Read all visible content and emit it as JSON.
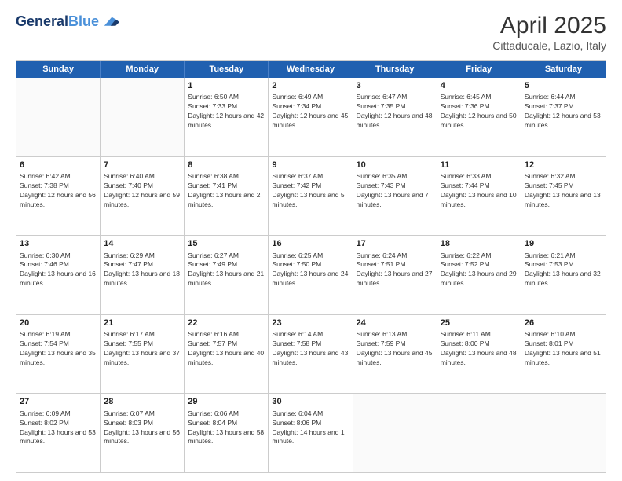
{
  "logo": {
    "line1": "General",
    "line2": "Blue"
  },
  "title": "April 2025",
  "subtitle": "Cittaducale, Lazio, Italy",
  "header_days": [
    "Sunday",
    "Monday",
    "Tuesday",
    "Wednesday",
    "Thursday",
    "Friday",
    "Saturday"
  ],
  "weeks": [
    [
      {
        "day": "",
        "info": ""
      },
      {
        "day": "",
        "info": ""
      },
      {
        "day": "1",
        "info": "Sunrise: 6:50 AM\nSunset: 7:33 PM\nDaylight: 12 hours and 42 minutes."
      },
      {
        "day": "2",
        "info": "Sunrise: 6:49 AM\nSunset: 7:34 PM\nDaylight: 12 hours and 45 minutes."
      },
      {
        "day": "3",
        "info": "Sunrise: 6:47 AM\nSunset: 7:35 PM\nDaylight: 12 hours and 48 minutes."
      },
      {
        "day": "4",
        "info": "Sunrise: 6:45 AM\nSunset: 7:36 PM\nDaylight: 12 hours and 50 minutes."
      },
      {
        "day": "5",
        "info": "Sunrise: 6:44 AM\nSunset: 7:37 PM\nDaylight: 12 hours and 53 minutes."
      }
    ],
    [
      {
        "day": "6",
        "info": "Sunrise: 6:42 AM\nSunset: 7:38 PM\nDaylight: 12 hours and 56 minutes."
      },
      {
        "day": "7",
        "info": "Sunrise: 6:40 AM\nSunset: 7:40 PM\nDaylight: 12 hours and 59 minutes."
      },
      {
        "day": "8",
        "info": "Sunrise: 6:38 AM\nSunset: 7:41 PM\nDaylight: 13 hours and 2 minutes."
      },
      {
        "day": "9",
        "info": "Sunrise: 6:37 AM\nSunset: 7:42 PM\nDaylight: 13 hours and 5 minutes."
      },
      {
        "day": "10",
        "info": "Sunrise: 6:35 AM\nSunset: 7:43 PM\nDaylight: 13 hours and 7 minutes."
      },
      {
        "day": "11",
        "info": "Sunrise: 6:33 AM\nSunset: 7:44 PM\nDaylight: 13 hours and 10 minutes."
      },
      {
        "day": "12",
        "info": "Sunrise: 6:32 AM\nSunset: 7:45 PM\nDaylight: 13 hours and 13 minutes."
      }
    ],
    [
      {
        "day": "13",
        "info": "Sunrise: 6:30 AM\nSunset: 7:46 PM\nDaylight: 13 hours and 16 minutes."
      },
      {
        "day": "14",
        "info": "Sunrise: 6:29 AM\nSunset: 7:47 PM\nDaylight: 13 hours and 18 minutes."
      },
      {
        "day": "15",
        "info": "Sunrise: 6:27 AM\nSunset: 7:49 PM\nDaylight: 13 hours and 21 minutes."
      },
      {
        "day": "16",
        "info": "Sunrise: 6:25 AM\nSunset: 7:50 PM\nDaylight: 13 hours and 24 minutes."
      },
      {
        "day": "17",
        "info": "Sunrise: 6:24 AM\nSunset: 7:51 PM\nDaylight: 13 hours and 27 minutes."
      },
      {
        "day": "18",
        "info": "Sunrise: 6:22 AM\nSunset: 7:52 PM\nDaylight: 13 hours and 29 minutes."
      },
      {
        "day": "19",
        "info": "Sunrise: 6:21 AM\nSunset: 7:53 PM\nDaylight: 13 hours and 32 minutes."
      }
    ],
    [
      {
        "day": "20",
        "info": "Sunrise: 6:19 AM\nSunset: 7:54 PM\nDaylight: 13 hours and 35 minutes."
      },
      {
        "day": "21",
        "info": "Sunrise: 6:17 AM\nSunset: 7:55 PM\nDaylight: 13 hours and 37 minutes."
      },
      {
        "day": "22",
        "info": "Sunrise: 6:16 AM\nSunset: 7:57 PM\nDaylight: 13 hours and 40 minutes."
      },
      {
        "day": "23",
        "info": "Sunrise: 6:14 AM\nSunset: 7:58 PM\nDaylight: 13 hours and 43 minutes."
      },
      {
        "day": "24",
        "info": "Sunrise: 6:13 AM\nSunset: 7:59 PM\nDaylight: 13 hours and 45 minutes."
      },
      {
        "day": "25",
        "info": "Sunrise: 6:11 AM\nSunset: 8:00 PM\nDaylight: 13 hours and 48 minutes."
      },
      {
        "day": "26",
        "info": "Sunrise: 6:10 AM\nSunset: 8:01 PM\nDaylight: 13 hours and 51 minutes."
      }
    ],
    [
      {
        "day": "27",
        "info": "Sunrise: 6:09 AM\nSunset: 8:02 PM\nDaylight: 13 hours and 53 minutes."
      },
      {
        "day": "28",
        "info": "Sunrise: 6:07 AM\nSunset: 8:03 PM\nDaylight: 13 hours and 56 minutes."
      },
      {
        "day": "29",
        "info": "Sunrise: 6:06 AM\nSunset: 8:04 PM\nDaylight: 13 hours and 58 minutes."
      },
      {
        "day": "30",
        "info": "Sunrise: 6:04 AM\nSunset: 8:06 PM\nDaylight: 14 hours and 1 minute."
      },
      {
        "day": "",
        "info": ""
      },
      {
        "day": "",
        "info": ""
      },
      {
        "day": "",
        "info": ""
      }
    ]
  ]
}
